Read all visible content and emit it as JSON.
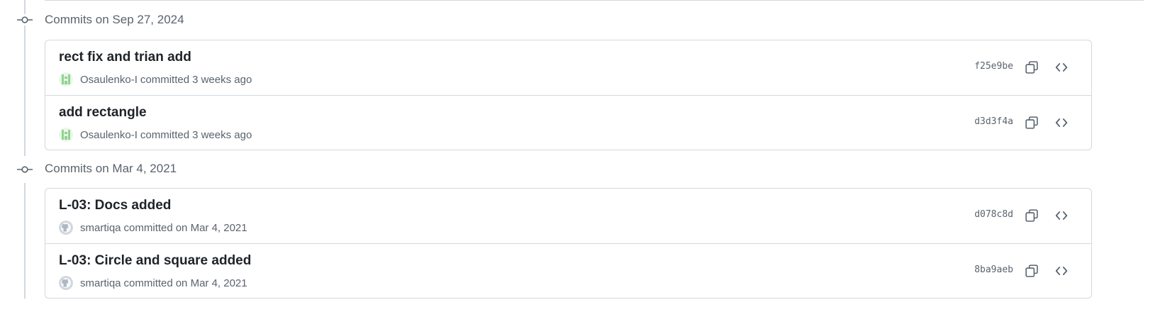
{
  "groups": [
    {
      "title": "Commits on Sep 27, 2024",
      "commits": [
        {
          "title": "rect fix and trian add",
          "author": "Osaulenko-I",
          "action": "committed",
          "time": "3 weeks ago",
          "sha": "f25e9be",
          "avatar": "identicon-green"
        },
        {
          "title": "add rectangle",
          "author": "Osaulenko-I",
          "action": "committed",
          "time": "3 weeks ago",
          "sha": "d3d3f4a",
          "avatar": "identicon-green"
        }
      ]
    },
    {
      "title": "Commits on Mar 4, 2021",
      "commits": [
        {
          "title": "L-03: Docs added",
          "author": "smartiqa",
          "action": "committed",
          "time": "on Mar 4, 2021",
          "sha": "d078c8d",
          "avatar": "github-default"
        },
        {
          "title": "L-03: Circle and square added",
          "author": "smartiqa",
          "action": "committed",
          "time": "on Mar 4, 2021",
          "sha": "8ba9aeb",
          "avatar": "github-default"
        }
      ]
    }
  ],
  "icons": {
    "timeline": "git-commit-icon",
    "copy": "copy-icon",
    "browse": "code-icon"
  },
  "colors": {
    "border": "#d1d9e0",
    "muted_text": "#59636e",
    "identicon": "#8fd48f"
  }
}
